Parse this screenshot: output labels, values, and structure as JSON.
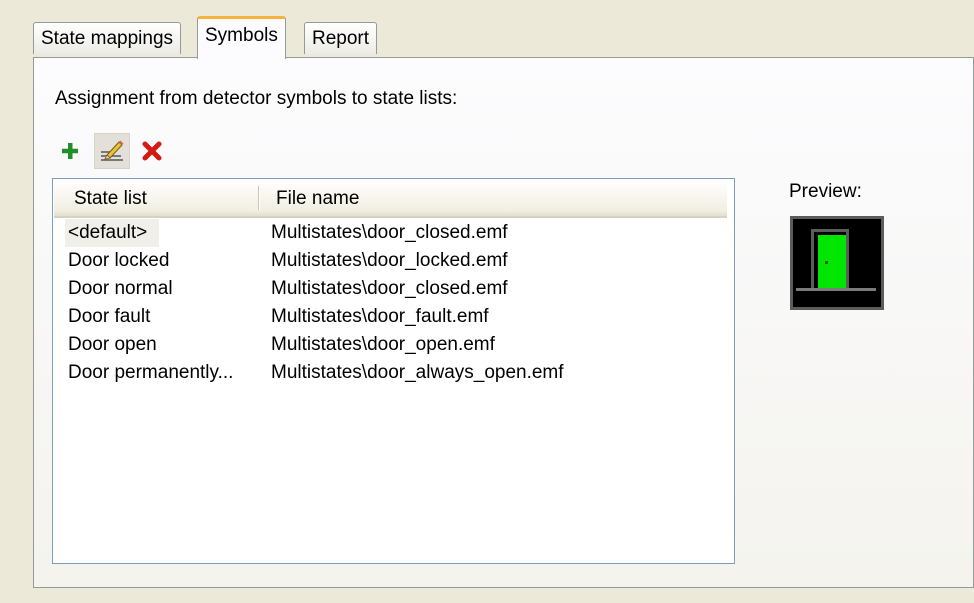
{
  "tabs": [
    {
      "label": "State mappings",
      "active": false
    },
    {
      "label": "Symbols",
      "active": true
    },
    {
      "label": "Report",
      "active": false
    }
  ],
  "caption": "Assignment from detector symbols to state lists:",
  "toolbar": {
    "add_icon": "plus-icon",
    "edit_icon": "edit-pencil-icon",
    "delete_icon": "delete-x-icon",
    "colors": {
      "add": "#1f8f2a",
      "delete": "#d41a12"
    }
  },
  "list": {
    "columns": [
      "State list",
      "File name"
    ],
    "rows": [
      {
        "state": "<default>",
        "file": "Multistates\\door_closed.emf",
        "selected": true
      },
      {
        "state": "Door locked",
        "file": "Multistates\\door_locked.emf"
      },
      {
        "state": "Door normal",
        "file": "Multistates\\door_closed.emf"
      },
      {
        "state": "Door fault",
        "file": "Multistates\\door_fault.emf"
      },
      {
        "state": "Door open",
        "file": "Multistates\\door_open.emf"
      },
      {
        "state": "Door permanently...",
        "file": "Multistates\\door_always_open.emf"
      }
    ]
  },
  "preview": {
    "label": "Preview:",
    "icon": "door-closed-icon",
    "colors": {
      "background": "#000000",
      "door": "#00e600",
      "frame": "#5c5c5c"
    }
  }
}
